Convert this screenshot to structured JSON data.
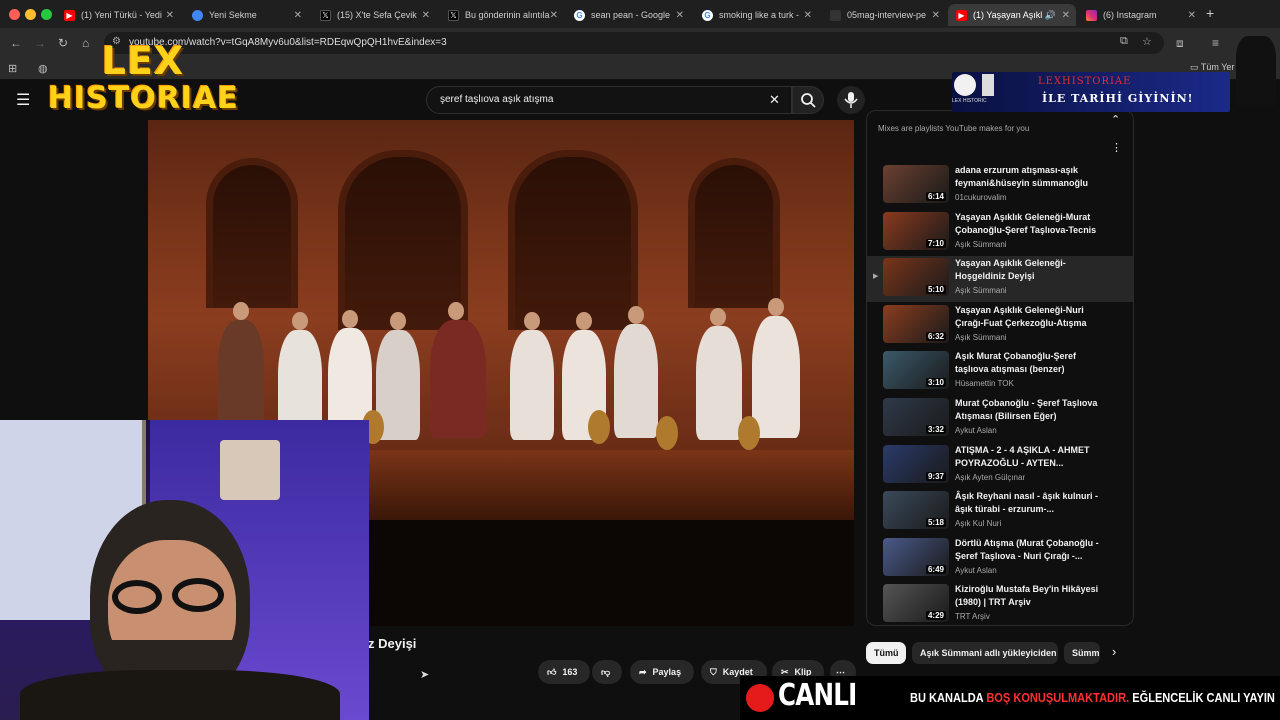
{
  "tabs": [
    {
      "label": "(1) Yeni Türkü - Yedi",
      "icon": "youtube-icon",
      "active": false
    },
    {
      "label": "Yeni Sekme",
      "icon": "chrome-icon",
      "active": false
    },
    {
      "label": "(15) X'te Sefa Çevik",
      "icon": "x-icon",
      "active": false
    },
    {
      "label": "Bu gönderinin alıntıla",
      "icon": "x-icon",
      "active": false
    },
    {
      "label": "sean pean - Google",
      "icon": "google-icon",
      "active": false
    },
    {
      "label": "smoking like a turk -",
      "icon": "google-icon",
      "active": false
    },
    {
      "label": "05mag-interview-pe",
      "icon": "page-icon",
      "active": false
    },
    {
      "label": "(1) Yaşayan Aşıkl",
      "icon": "youtube-icon",
      "active": true
    },
    {
      "label": "(6) Instagram",
      "icon": "instagram-icon",
      "active": false
    }
  ],
  "new_tab": "+",
  "url": "youtube.com/watch?v=tGqA8Myv6u0&list=RDEqwQpQH1hvE&index=3",
  "bookmarks_right": "Tüm Yer",
  "search": {
    "value": "şeref taşlıova aşık atışma"
  },
  "logo": {
    "line1": "LEX",
    "line2": "HISTORIAE"
  },
  "banner": {
    "line1": "LEXHISTORIAE",
    "line2": "İLE TARİHİ GİYİNİN!",
    "brand": "LEX HISTORIC"
  },
  "playlist": {
    "subtitle": "Mixes are playlists YouTube makes for you",
    "items": [
      {
        "title": "adana erzurum atışması-aşık feymani&hüseyin sümmanoğlu",
        "channel": "01cukurovalim",
        "duration": "6:14",
        "active": false,
        "color": "#6b4030"
      },
      {
        "title": "Yaşayan Aşıklık Geleneği-Murat Çobanoğlu-Şeref Taşlıova-Tecnis",
        "channel": "Aşık Sümmani",
        "duration": "7:10",
        "active": false,
        "color": "#8a3a1e"
      },
      {
        "title": "Yaşayan Aşıklık Geleneği-Hoşgeldiniz Deyişi",
        "channel": "Aşık Sümmani",
        "duration": "5:10",
        "active": true,
        "color": "#7a351a"
      },
      {
        "title": "Yaşayan Aşıklık Geleneği-Nuri Çırağı-Fuat Çerkezoğlu-Atışma",
        "channel": "Aşık Sümmani",
        "duration": "6:32",
        "active": false,
        "color": "#8b3d1f"
      },
      {
        "title": "Aşık Murat Çobanoğlu-Şeref taşlıova atışması (benzer)",
        "channel": "Hüsamettin TOK",
        "duration": "3:10",
        "active": false,
        "color": "#3b5a6b"
      },
      {
        "title": "Murat Çobanoğlu - Şeref Taşlıova Atışması (Bilirsen Eğer)",
        "channel": "Aykut Aslan",
        "duration": "3:32",
        "active": false,
        "color": "#2e3a4a"
      },
      {
        "title": "ATIŞMA - 2 - 4 AŞIKLA - AHMET POYRAZOĞLU - AYTEN...",
        "channel": "Aşık Ayten Gülçınar",
        "duration": "9:37",
        "active": false,
        "color": "#2a3a6a"
      },
      {
        "title": "Âşık Reyhani nasıl - âşık kulnuri - âşık türabi - erzurum-...",
        "channel": "Aşık Kul Nuri",
        "duration": "5:18",
        "active": false,
        "color": "#3a4a5a"
      },
      {
        "title": "Dörtlü Atışma (Murat Çobanoğlu - Şeref Taşlıova - Nuri Çırağı -...",
        "channel": "Aykut Aslan",
        "duration": "6:49",
        "active": false,
        "color": "#4a5a8a"
      },
      {
        "title": "Kiziroğlu Mustafa Bey'in Hikâyesi (1980) | TRT Arşiv",
        "channel": "TRT Arşiv",
        "duration": "4:29",
        "active": false,
        "color": "#555555"
      }
    ]
  },
  "chips": [
    "Tümü",
    "Aşık Sümmani adlı yükleyiciden",
    "Sümm"
  ],
  "video": {
    "title_partial": "z Deyişi"
  },
  "actions": {
    "likes": "163",
    "share": "Paylaş",
    "save": "Kaydet",
    "clip": "Klip"
  },
  "live_bar": {
    "live": "CANLI",
    "part1": "BU KANALDA ",
    "part2": "BOŞ KONUŞULMAKTADIR.",
    "part3": " EĞLENCELİK CANLI YAYIN"
  }
}
